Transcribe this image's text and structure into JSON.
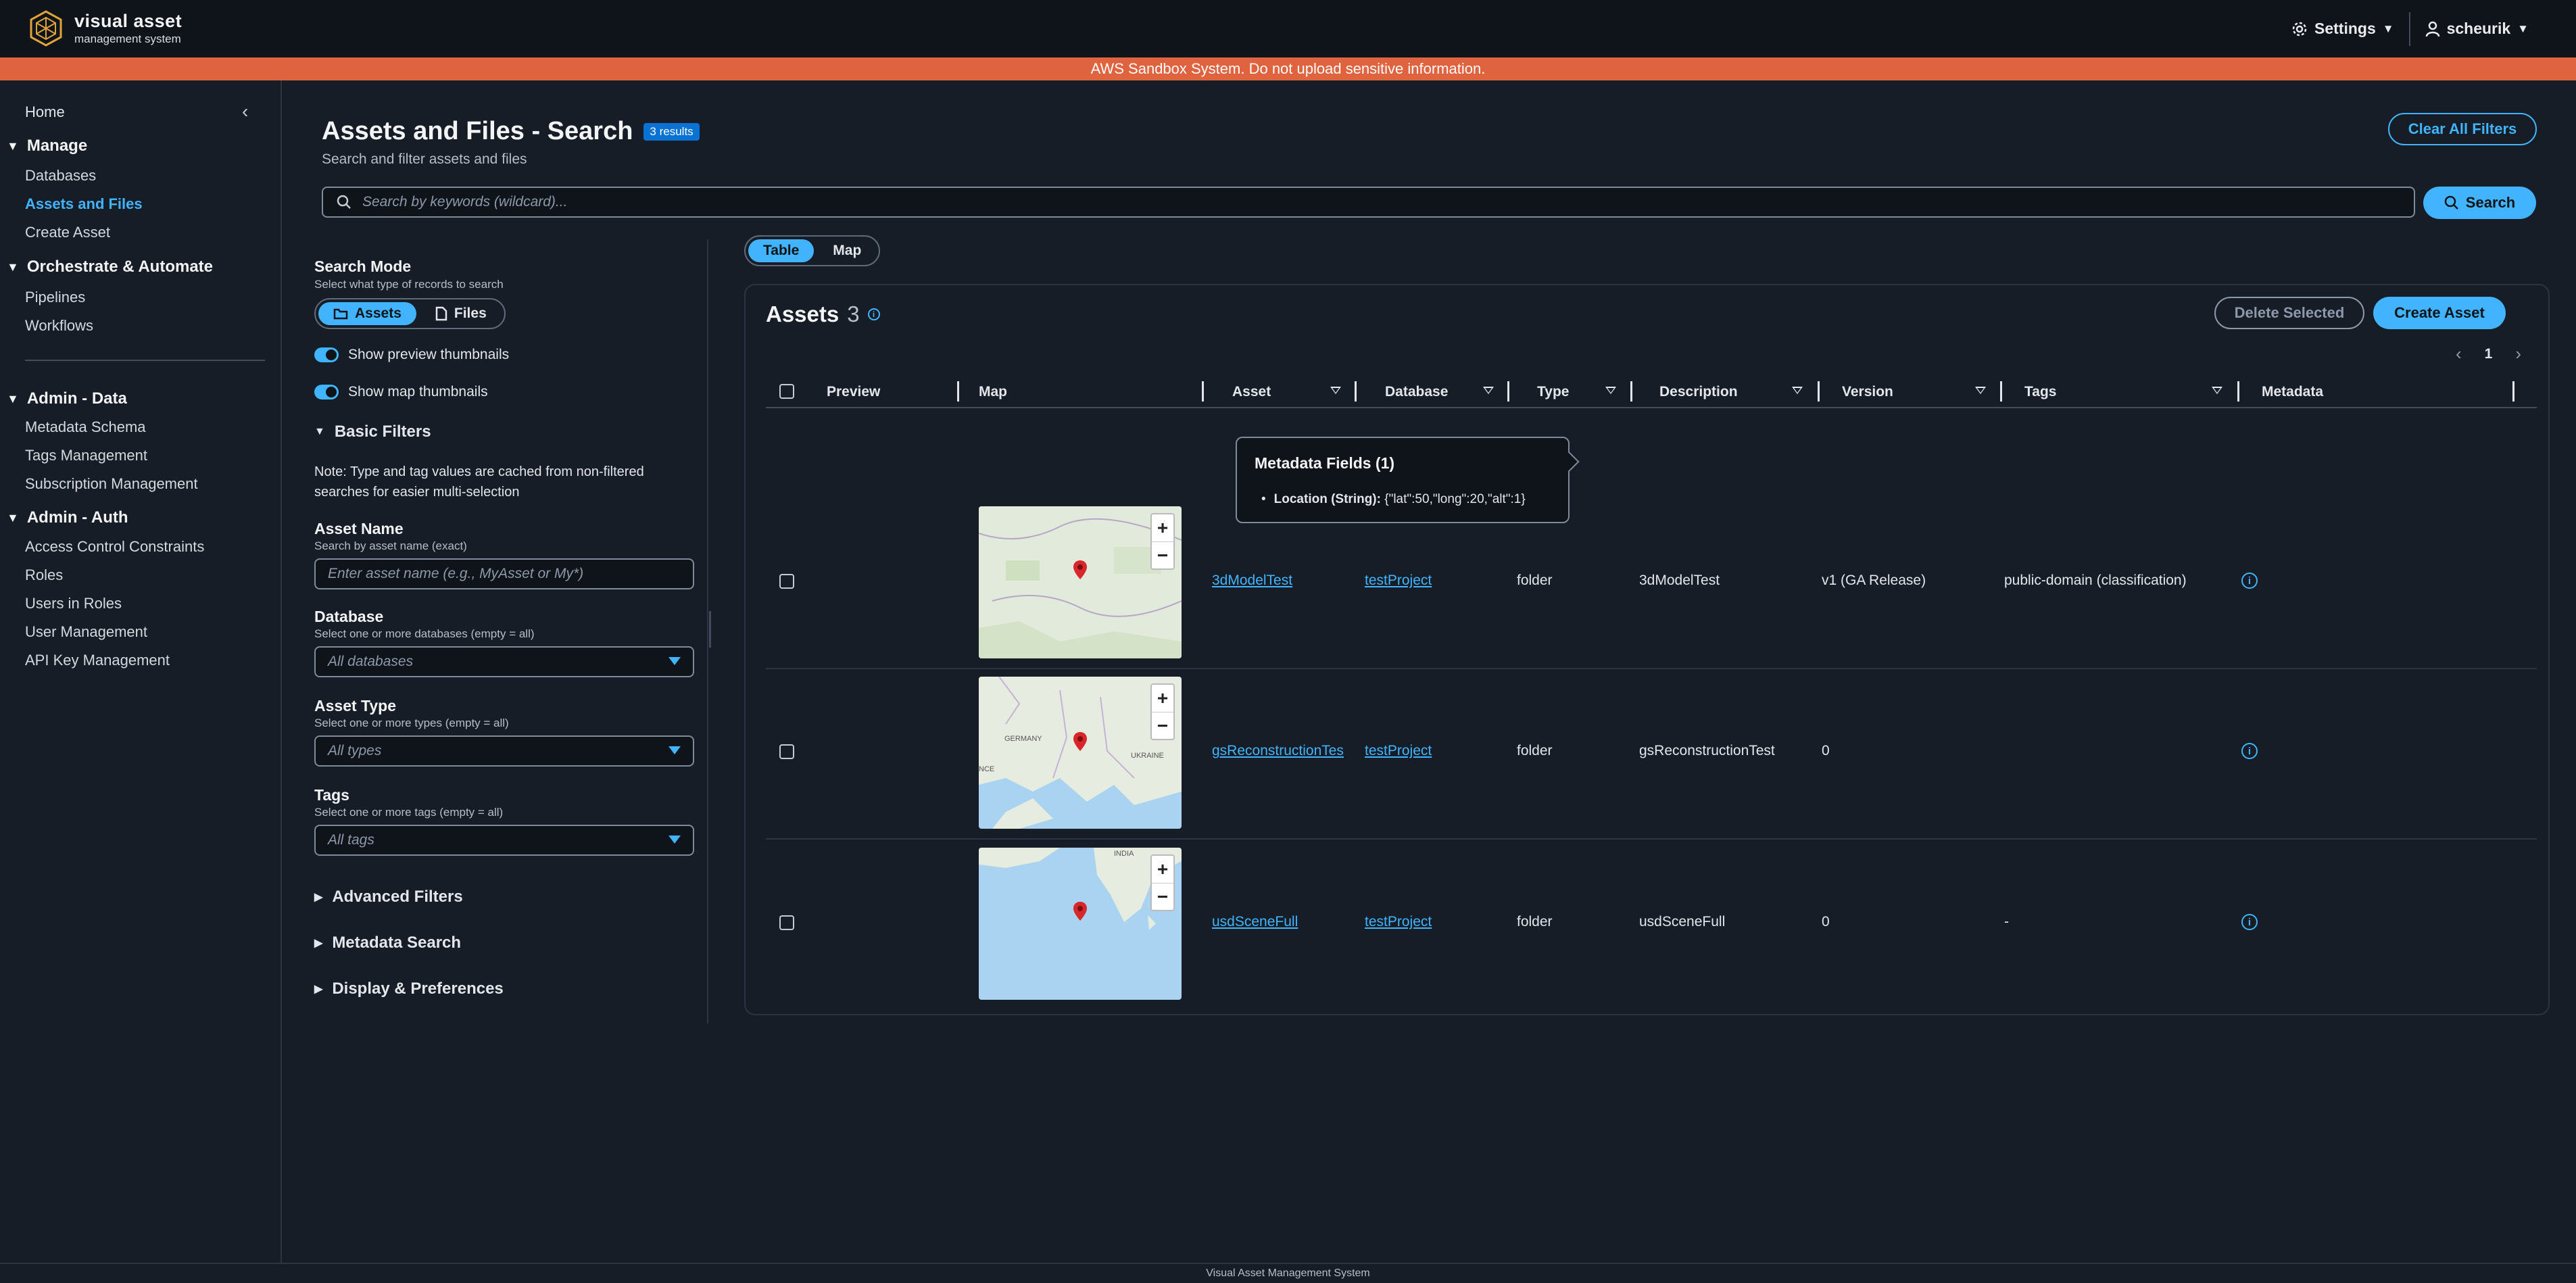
{
  "app": {
    "logo_line1": "visual asset",
    "logo_line2": "management system",
    "settings_label": "Settings",
    "user_label": "scheurik"
  },
  "banner": "AWS Sandbox System. Do not upload sensitive information.",
  "sidebar": {
    "home": "Home",
    "sections": [
      {
        "title": "Manage",
        "items": [
          "Databases",
          "Assets and Files",
          "Create Asset"
        ]
      },
      {
        "title": "Orchestrate & Automate",
        "items": [
          "Pipelines",
          "Workflows"
        ]
      },
      {
        "title": "Admin - Data",
        "items": [
          "Metadata Schema",
          "Tags Management",
          "Subscription Management"
        ]
      },
      {
        "title": "Admin - Auth",
        "items": [
          "Access Control Constraints",
          "Roles",
          "Users in Roles",
          "User Management",
          "API Key Management"
        ]
      }
    ],
    "active_item": "Assets and Files"
  },
  "page": {
    "title": "Assets and Files - Search",
    "results_badge": "3 results",
    "subtitle": "Search and filter assets and files",
    "clear_all": "Clear All Filters",
    "search_placeholder": "Search by keywords (wildcard)...",
    "search_button": "Search"
  },
  "filters": {
    "search_mode_label": "Search Mode",
    "search_mode_desc": "Select what type of records to search",
    "mode_assets": "Assets",
    "mode_files": "Files",
    "toggle_preview": "Show preview thumbnails",
    "toggle_map": "Show map thumbnails",
    "basic_filters": "Basic Filters",
    "note": "Note: Type and tag values are cached from non-filtered searches for easier multi-selection",
    "asset_name_label": "Asset Name",
    "asset_name_desc": "Search by asset name (exact)",
    "asset_name_placeholder": "Enter asset name (e.g., MyAsset or My*)",
    "database_label": "Database",
    "database_desc": "Select one or more databases (empty = all)",
    "database_value": "All databases",
    "type_label": "Asset Type",
    "type_desc": "Select one or more types (empty = all)",
    "type_value": "All types",
    "tags_label": "Tags",
    "tags_desc": "Select one or more tags (empty = all)",
    "tags_value": "All tags",
    "advanced": "Advanced Filters",
    "metadata_search": "Metadata Search",
    "display_prefs": "Display & Preferences"
  },
  "view": {
    "table": "Table",
    "map": "Map"
  },
  "table": {
    "title": "Assets",
    "count": "3",
    "delete_selected": "Delete Selected",
    "create_asset": "Create Asset",
    "page": "1",
    "columns": [
      "Preview",
      "Map",
      "Asset",
      "Database",
      "Type",
      "Description",
      "Version",
      "Tags",
      "Metadata"
    ],
    "rows": [
      {
        "asset": "3dModelTest",
        "database": "testProject",
        "type": "folder",
        "description": "3dModelTest",
        "version": "v1 (GA Release)",
        "tags": "public-domain (classification)"
      },
      {
        "asset": "gsReconstructionTes",
        "database": "testProject",
        "type": "folder",
        "description": "gsReconstructionTest",
        "version": "0",
        "tags": ""
      },
      {
        "asset": "usdSceneFull",
        "database": "testProject",
        "type": "folder",
        "description": "usdSceneFull",
        "version": "0",
        "tags": "-"
      }
    ],
    "map_labels": {
      "germany": "GERMANY",
      "ukraine": "UKRAINE",
      "france": "NCE",
      "india": "INDIA"
    }
  },
  "popover": {
    "title": "Metadata Fields (1)",
    "field_name": "Location (String):",
    "field_value": "{\"lat\":50,\"long\":20,\"alt\":1}"
  },
  "footer": "Visual Asset Management System",
  "colors": {
    "accent": "#42b4ff",
    "banner": "#e06340",
    "background": "#161d26"
  }
}
